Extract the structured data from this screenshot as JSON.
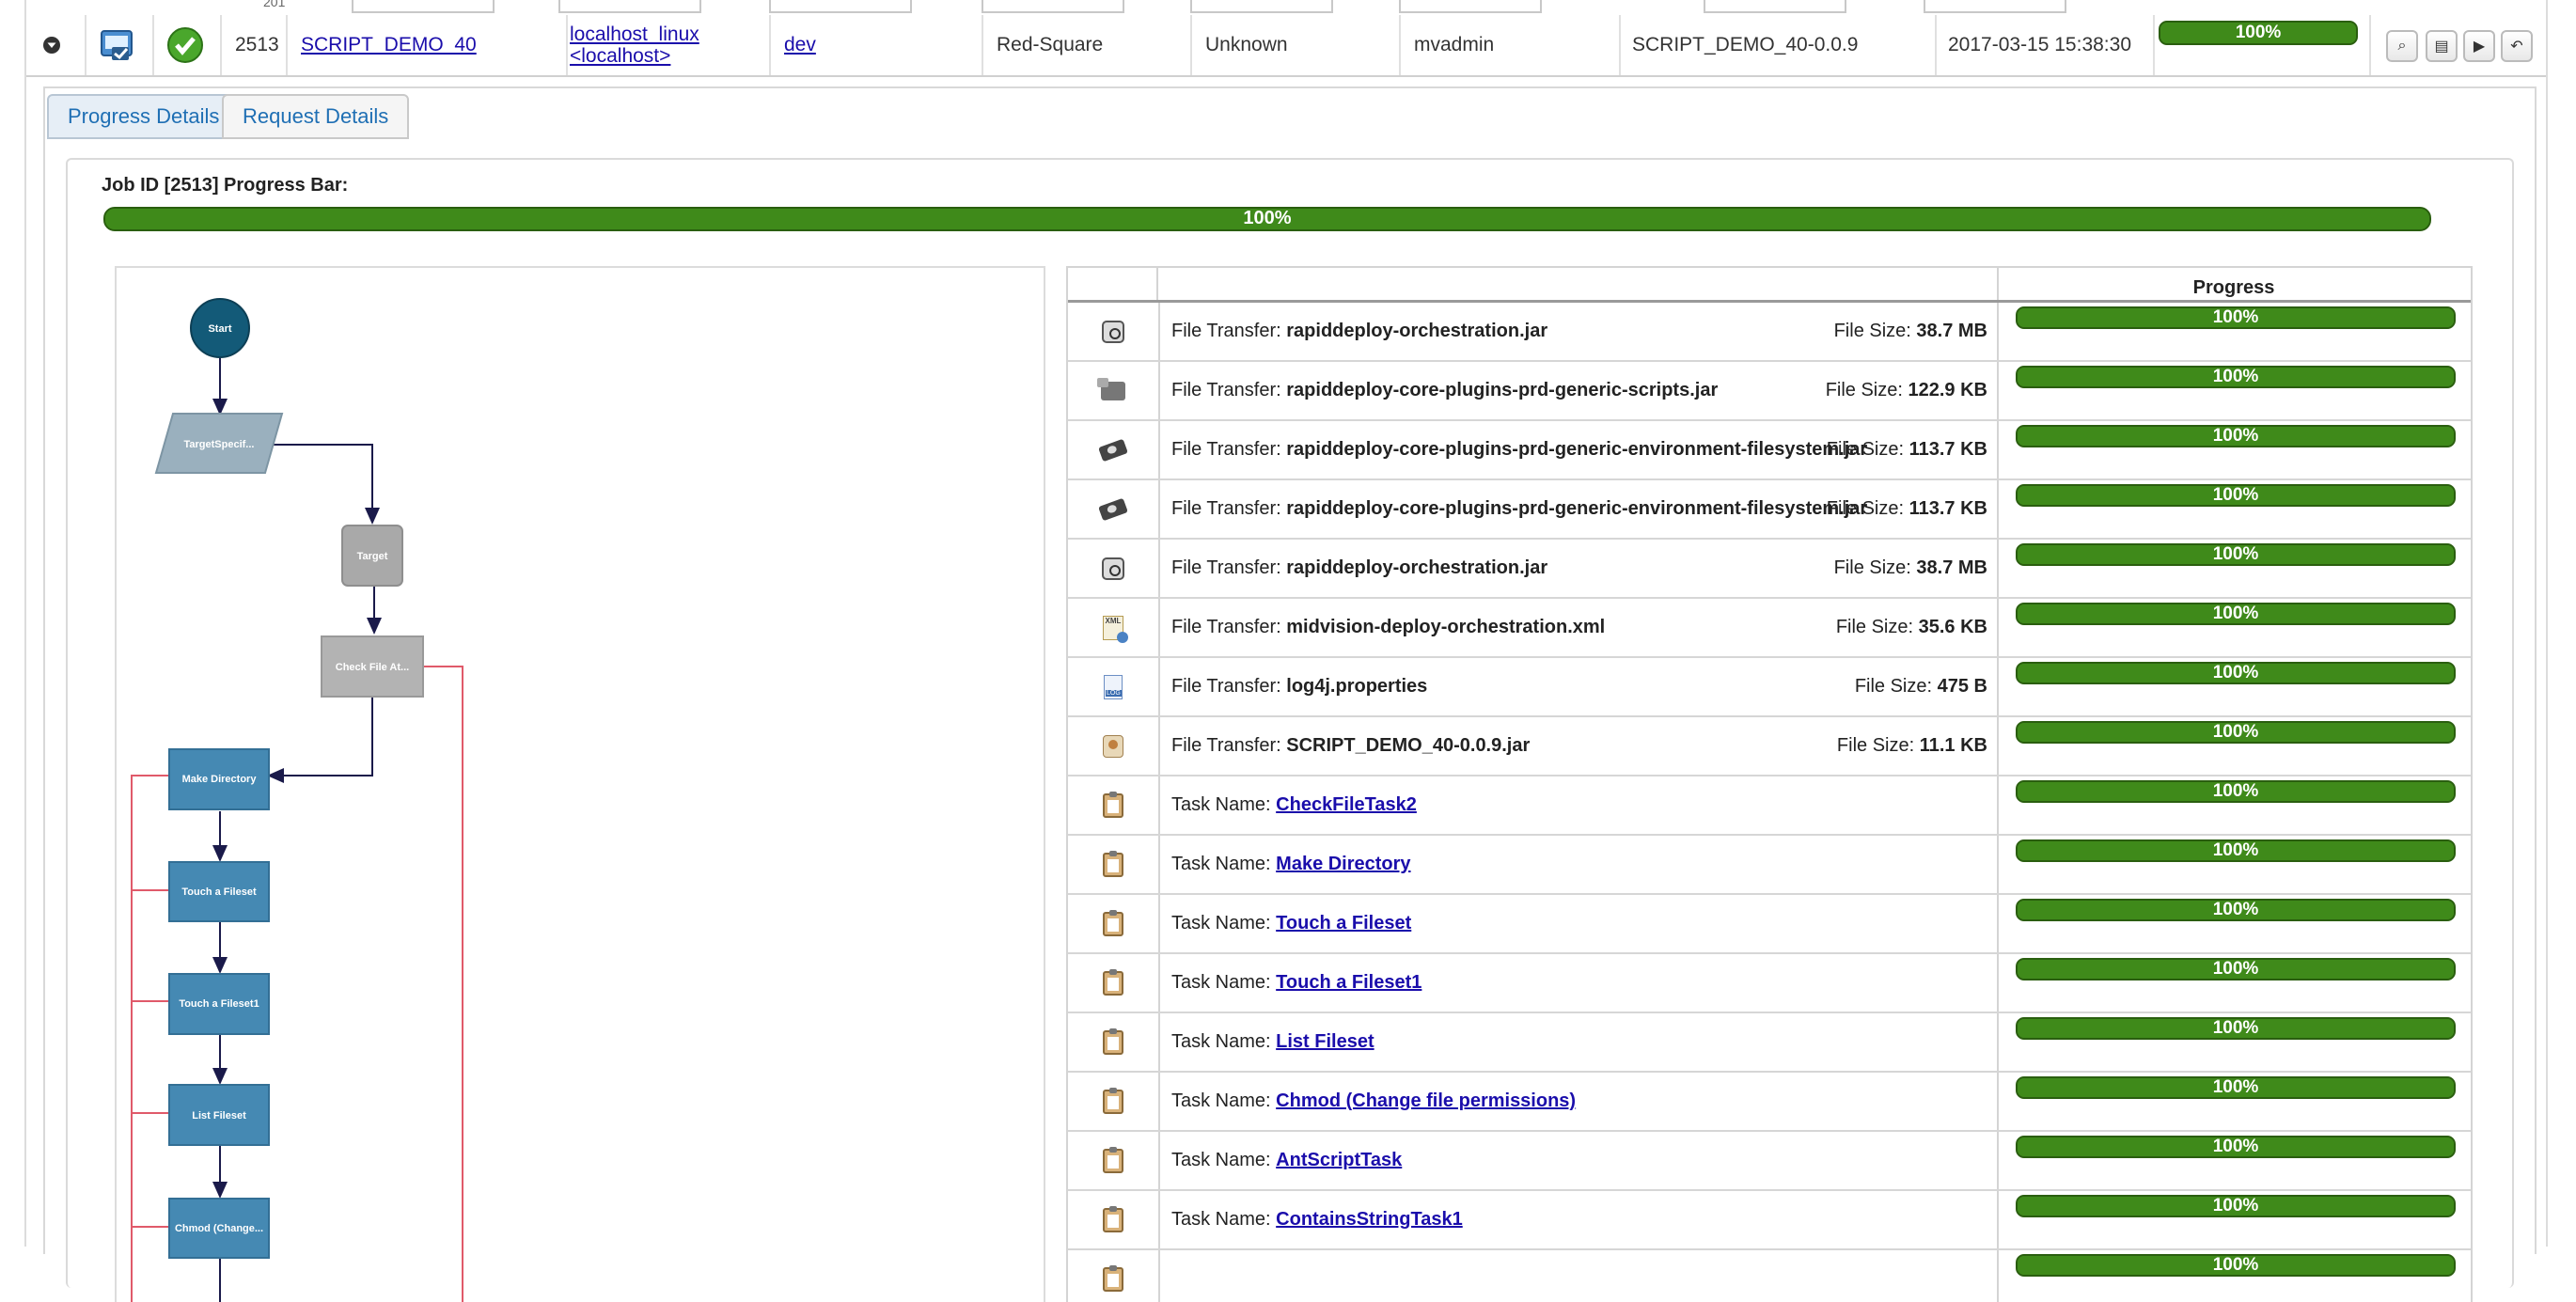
{
  "filter_row": {
    "partial_text": "201"
  },
  "job": {
    "id": "2513",
    "project": "SCRIPT_DEMO_40",
    "server_line1": "localhost_linux",
    "server_line2": "<localhost>",
    "environment": "dev",
    "target": "Red-Square",
    "state": "Unknown",
    "user": "mvadmin",
    "package": "SCRIPT_DEMO_40-0.0.9",
    "date": "2017-03-15 15:38:30",
    "progress_label": "100%",
    "progress_value": 100
  },
  "tabs": [
    {
      "label": "Progress Details"
    },
    {
      "label": "Request Details"
    }
  ],
  "progress_panel": {
    "title": "Job ID [2513] Progress Bar:",
    "bar_label": "100%",
    "bar_value": 100
  },
  "diagram": {
    "nodes": {
      "start": "Start",
      "target_specific": "TargetSpecif...",
      "target": "Target",
      "check_file": "Check File At...",
      "make_directory": "Make Directory",
      "touch_fileset": "Touch a Fileset",
      "touch_fileset1": "Touch a Fileset1",
      "list_fileset": "List Fileset",
      "chmod": "Chmod (Change..."
    }
  },
  "table": {
    "header_progress": "Progress",
    "file_prefix": "File Transfer: ",
    "size_prefix": "File Size: ",
    "task_prefix": "Task Name: ",
    "rows": [
      {
        "kind": "file",
        "icon": "jar-icon",
        "name": "rapiddeploy-orchestration.jar",
        "size": "38.7 MB",
        "progress": "100%"
      },
      {
        "kind": "file",
        "icon": "plugin-icon",
        "name": "rapiddeploy-core-plugins-prd-generic-scripts.jar",
        "size": "122.9 KB",
        "progress": "100%"
      },
      {
        "kind": "file",
        "icon": "gear-icon",
        "name": "rapiddeploy-core-plugins-prd-generic-environment-filesystem.jar",
        "size": "113.7 KB",
        "progress": "100%"
      },
      {
        "kind": "file",
        "icon": "gear-icon",
        "name": "rapiddeploy-core-plugins-prd-generic-environment-filesystem.jar",
        "size": "113.7 KB",
        "progress": "100%"
      },
      {
        "kind": "file",
        "icon": "jar-icon",
        "name": "rapiddeploy-orchestration.jar",
        "size": "38.7 MB",
        "progress": "100%"
      },
      {
        "kind": "file",
        "icon": "xml-icon",
        "name": "midvision-deploy-orchestration.xml",
        "size": "35.6 KB",
        "progress": "100%"
      },
      {
        "kind": "file",
        "icon": "log-icon",
        "name": "log4j.properties",
        "size": "475 B",
        "progress": "100%"
      },
      {
        "kind": "file",
        "icon": "script-jar-icon",
        "name": "SCRIPT_DEMO_40-0.0.9.jar",
        "size": "11.1 KB",
        "progress": "100%"
      },
      {
        "kind": "task",
        "icon": "clipboard-icon",
        "name": "CheckFileTask2",
        "progress": "100%"
      },
      {
        "kind": "task",
        "icon": "clipboard-icon",
        "name": "Make Directory",
        "progress": "100%"
      },
      {
        "kind": "task",
        "icon": "clipboard-icon",
        "name": "Touch a Fileset",
        "progress": "100%"
      },
      {
        "kind": "task",
        "icon": "clipboard-icon",
        "name": "Touch a Fileset1",
        "progress": "100%"
      },
      {
        "kind": "task",
        "icon": "clipboard-icon",
        "name": "List Fileset",
        "progress": "100%"
      },
      {
        "kind": "task",
        "icon": "clipboard-icon",
        "name": "Chmod (Change file permissions)",
        "progress": "100%"
      },
      {
        "kind": "task",
        "icon": "clipboard-icon",
        "name": "AntScriptTask",
        "progress": "100%"
      },
      {
        "kind": "task",
        "icon": "clipboard-icon",
        "name": "ContainsStringTask1",
        "progress": "100%"
      },
      {
        "kind": "task",
        "icon": "clipboard-icon",
        "name": "",
        "progress": "100%"
      }
    ]
  },
  "colors": {
    "progress_green": "#428b1f",
    "node_blue": "#4589b3",
    "node_gray": "#a9a9a9",
    "start_teal": "#135a78",
    "tab_link": "#1f6fb4"
  }
}
